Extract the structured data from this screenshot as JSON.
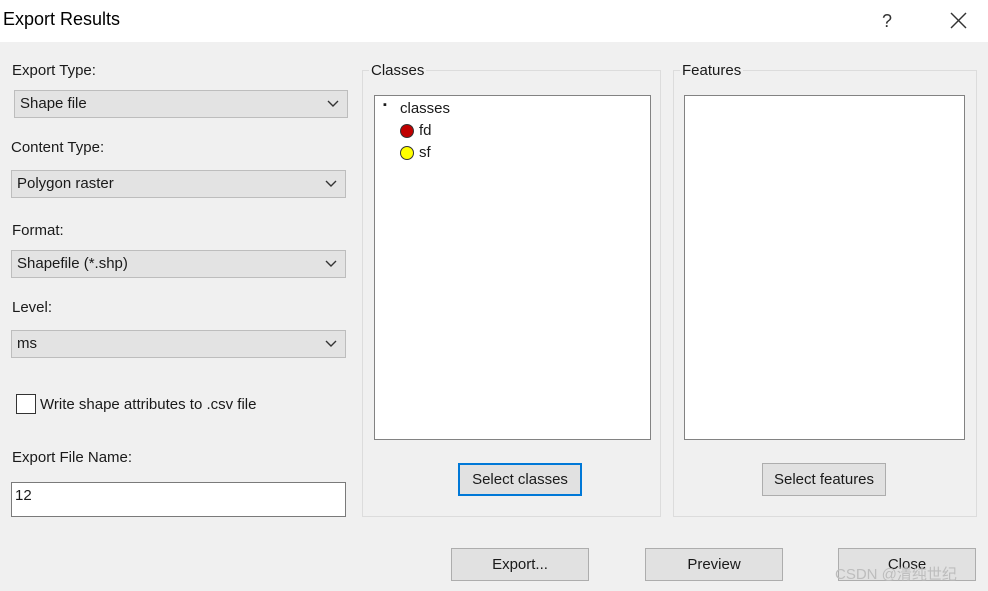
{
  "window": {
    "title": "Export Results",
    "help_label": "?"
  },
  "left": {
    "export_type_label": "Export Type:",
    "export_type_value": "Shape file",
    "content_type_label": "Content Type:",
    "content_type_value": "Polygon raster",
    "format_label": "Format:",
    "format_value": "Shapefile (*.shp)",
    "level_label": "Level:",
    "level_value": "ms",
    "write_csv_label": "Write shape attributes to .csv file",
    "write_csv_checked": false,
    "file_name_label": "Export File Name:",
    "file_name_value": "12"
  },
  "classes": {
    "group_label": "Classes",
    "root_label": "classes",
    "root_bullet": "▪",
    "items": [
      {
        "label": "fd",
        "color": "#c00000"
      },
      {
        "label": "sf",
        "color": "#ffff00"
      }
    ],
    "select_button": "Select classes"
  },
  "features": {
    "group_label": "Features",
    "select_button": "Select features"
  },
  "footer": {
    "export_button": "Export...",
    "preview_button": "Preview",
    "close_button": "Close"
  },
  "watermark": "CSDN @清纯世纪"
}
